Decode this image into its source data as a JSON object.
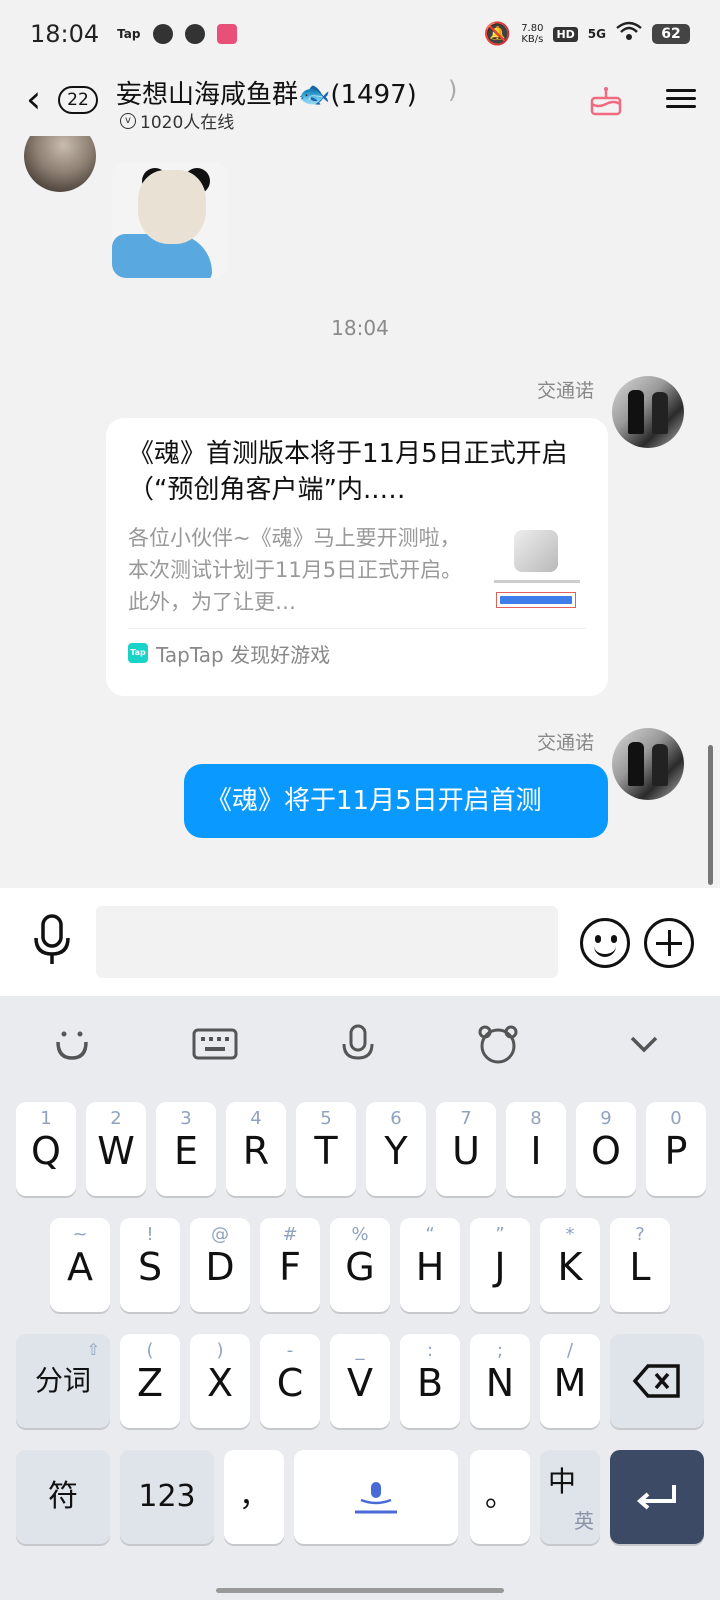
{
  "status_bar": {
    "time": "18:04",
    "app_label": "Tap",
    "net_speed_value": "7.80",
    "net_speed_unit": "KB/s",
    "hd": "HD",
    "network": "5G",
    "battery": "62"
  },
  "header": {
    "unread_count": "22",
    "title": "妄想山海咸鱼群🐟(1497)",
    "online": "1020人在线"
  },
  "messages": {
    "timestamp": "18:04",
    "card": {
      "sender": "交通诺",
      "title": "《魂》首测版本将于11月5日正式开启（“预创角客户端”内..…",
      "description": "各位小伙伴~《魂》马上要开测啦，本次测试计划于11月5日正式开启。此外，为了让更…",
      "source": "TapTap 发现好游戏",
      "source_logo": "Tap"
    },
    "text_message": {
      "sender": "交通诺",
      "text": "《魂》将于11月5日开启首测"
    }
  },
  "input": {
    "placeholder": ""
  },
  "keyboard": {
    "row1": [
      {
        "sub": "1",
        "main": "Q"
      },
      {
        "sub": "2",
        "main": "W"
      },
      {
        "sub": "3",
        "main": "E"
      },
      {
        "sub": "4",
        "main": "R"
      },
      {
        "sub": "5",
        "main": "T"
      },
      {
        "sub": "6",
        "main": "Y"
      },
      {
        "sub": "7",
        "main": "U"
      },
      {
        "sub": "8",
        "main": "I"
      },
      {
        "sub": "9",
        "main": "O"
      },
      {
        "sub": "0",
        "main": "P"
      }
    ],
    "row2": [
      {
        "sub": "~",
        "main": "A"
      },
      {
        "sub": "!",
        "main": "S"
      },
      {
        "sub": "@",
        "main": "D"
      },
      {
        "sub": "#",
        "main": "F"
      },
      {
        "sub": "%",
        "main": "G"
      },
      {
        "sub": "“",
        "main": "H"
      },
      {
        "sub": "”",
        "main": "J"
      },
      {
        "sub": "*",
        "main": "K"
      },
      {
        "sub": "?",
        "main": "L"
      }
    ],
    "row3": [
      {
        "sub": "(",
        "main": "Z"
      },
      {
        "sub": ")",
        "main": "X"
      },
      {
        "sub": "-",
        "main": "C"
      },
      {
        "sub": "_",
        "main": "V"
      },
      {
        "sub": ":",
        "main": "B"
      },
      {
        "sub": ";",
        "main": "N"
      },
      {
        "sub": "/",
        "main": "M"
      }
    ],
    "segment_label": "分词",
    "symbol_label": "符",
    "numeric_label": "123",
    "comma_label": "，",
    "period_label": "。",
    "lang_primary": "中",
    "lang_secondary": "英"
  }
}
